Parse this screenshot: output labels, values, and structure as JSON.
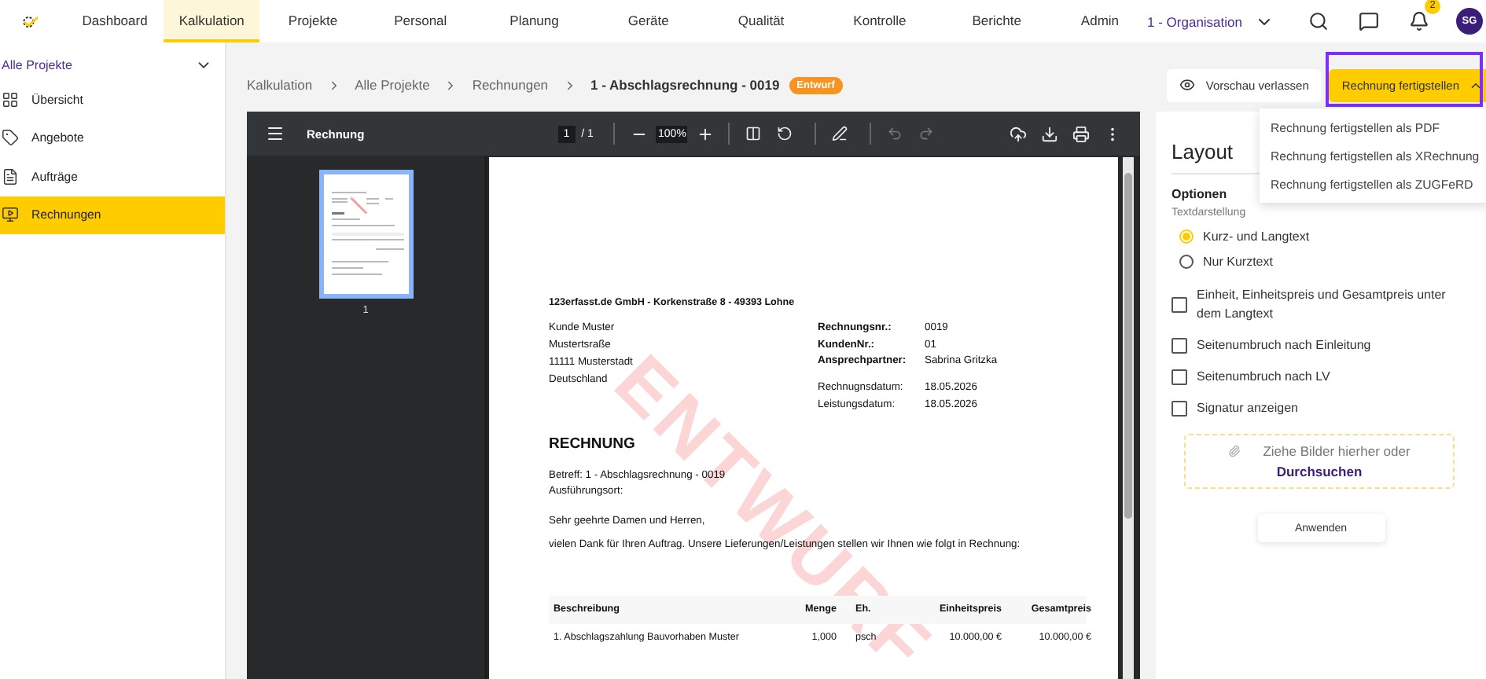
{
  "nav": {
    "items": [
      {
        "label": "Dashboard",
        "selected": false
      },
      {
        "label": "Kalkulation",
        "selected": true
      },
      {
        "label": "Projekte",
        "selected": false
      },
      {
        "label": "Personal",
        "selected": false
      },
      {
        "label": "Planung",
        "selected": false
      },
      {
        "label": "Geräte",
        "selected": false
      },
      {
        "label": "Qualität",
        "selected": false
      },
      {
        "label": "Kontrolle",
        "selected": false
      },
      {
        "label": "Berichte",
        "selected": false
      },
      {
        "label": "Admin",
        "selected": false
      }
    ],
    "organisation": "1 - Organisation",
    "notifications": "2",
    "avatar": "SG"
  },
  "sidebar": {
    "project": "Alle Projekte",
    "items": [
      {
        "label": "Übersicht",
        "selected": false
      },
      {
        "label": "Angebote",
        "selected": false
      },
      {
        "label": "Aufträge",
        "selected": false
      },
      {
        "label": "Rechnungen",
        "selected": true
      }
    ]
  },
  "breadcrumb": [
    "Kalkulation",
    "Alle Projekte",
    "Rechnungen",
    "1 - Abschlagsrechnung - 0019"
  ],
  "status_badge": "Entwurf",
  "actions": {
    "leave_preview": "Vorschau verlassen",
    "finish": "Rechnung fertigstellen",
    "finish_menu": [
      "Rechnung fertigstellen als PDF",
      "Rechnung fertigstellen als XRechnung",
      "Rechnung fertigstellen als ZUGFeRD"
    ]
  },
  "viewer": {
    "title": "Rechnung",
    "page": "1",
    "page_total": "/ 1",
    "zoom": "100%",
    "thumbnail_label": "1"
  },
  "document": {
    "sender": "123erfasst.de GmbH - Korkenstraße 8 - 49393 Lohne",
    "address": [
      "Kunde Muster",
      "Mustertsraße",
      "11111 Musterstadt",
      "Deutschland"
    ],
    "meta": [
      {
        "label": "Rechnungsnr.:",
        "value": "0019"
      },
      {
        "label": "KundenNr.:",
        "value": "01"
      },
      {
        "label": "Ansprechpartner:",
        "value": "Sabrina Gritzka"
      }
    ],
    "dates": [
      {
        "label": "Rechnugnsdatum:",
        "value": "18.05.2026"
      },
      {
        "label": "Leistungsdatum:",
        "value": "18.05.2026"
      }
    ],
    "heading": "RECHNUNG",
    "subject_lines": [
      "Betreff: 1 - Abschlagsrechnung - 0019",
      "Ausführungsort:"
    ],
    "salutation": "Sehr geehrte Damen und Herren,",
    "intro": "vielen Dank für Ihren Auftrag. Unsere Lieferungen/Leistungen stellen wir Ihnen wie folgt in Rechnung:",
    "table": {
      "columns": [
        "Beschreibung",
        "Menge",
        "Eh.",
        "Einheitspreis",
        "Gesamtpreis"
      ],
      "rows": [
        [
          "1. Abschlagszahlung Bauvorhaben Muster",
          "1,000",
          "psch",
          "10.000,00 €",
          "10.000,00 €"
        ]
      ]
    },
    "stamp": "ENTWURF"
  },
  "layout_panel": {
    "title": "Layout",
    "section": "Optionen",
    "group_label": "Textdarstellung",
    "radios": [
      {
        "label": "Kurz- und Langtext",
        "selected": true
      },
      {
        "label": "Nur Kurztext",
        "selected": false
      }
    ],
    "checkboxes": [
      {
        "label": "Einheit, Einheitspreis und Gesamtpreis unter dem Langtext",
        "checked": false
      },
      {
        "label": "Seitenumbruch nach Einleitung",
        "checked": false
      },
      {
        "label": "Seitenumbruch nach LV",
        "checked": false
      },
      {
        "label": "Signatur anzeigen",
        "checked": false
      }
    ],
    "dropzone": {
      "text": "Ziehe Bilder hierher oder",
      "link": "Durchsuchen"
    },
    "apply": "Anwenden"
  }
}
